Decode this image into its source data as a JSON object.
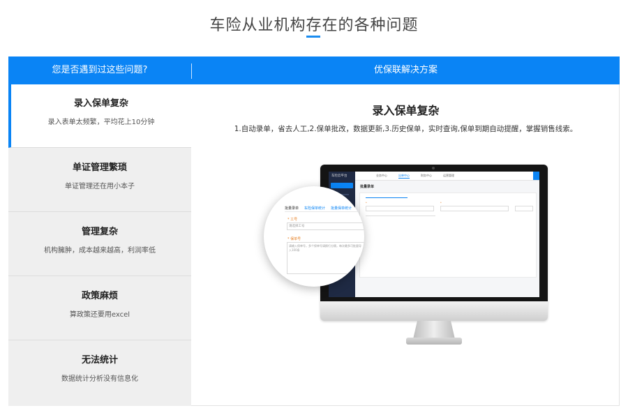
{
  "page": {
    "title": "车险从业机构存在的各种问题",
    "accent_color": "#0a84f5"
  },
  "header": {
    "left": "您是否遇到过这些问题?",
    "right": "优保联解决方案"
  },
  "sidebar": {
    "items": [
      {
        "title": "录入保单复杂",
        "desc": "录入表单太频繁，平均花上10分钟",
        "active": true
      },
      {
        "title": "单证管理繁琐",
        "desc": "单证管理还在用小本子",
        "active": false
      },
      {
        "title": "管理复杂",
        "desc": "机构臃肿，成本越来越高，利润率低",
        "active": false
      },
      {
        "title": "政策麻烦",
        "desc": "算政策还要用excel",
        "active": false
      },
      {
        "title": "无法统计",
        "desc": "数据统计分析没有信息化",
        "active": false
      }
    ]
  },
  "content": {
    "title": "录入保单复杂",
    "desc": "1.自动录单，省去人工,2.保单批改，数据更新,3.历史保单，实时查询,保单到期自动提醒，掌握销售线索。"
  },
  "screen": {
    "brand": "车险云平台",
    "tabs": [
      "业务中心",
      "出单中心",
      "财务中心",
      "运营管理"
    ],
    "active_tab": 1,
    "page_title": "批量录单"
  },
  "magnifier": {
    "tabs": [
      "批量录单",
      "车险保单统计",
      "批量保单统计"
    ],
    "field1_label": "* 工号",
    "field1_placeholder": "请选择工号",
    "field2_label": "* 保单号",
    "field2_placeholder": "请输入保单号，多个保单号请换行分隔，每次最多可批量导入100条"
  }
}
